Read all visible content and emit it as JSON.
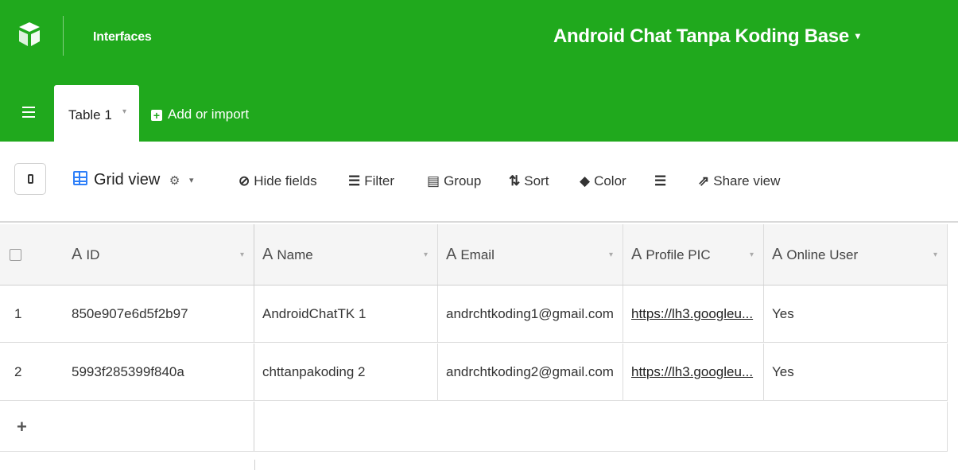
{
  "header": {
    "interfaces_label": "Interfaces",
    "base_title": "Android Chat Tanpa Koding Base",
    "base_caret": "▾",
    "brand_color": "#20a91d"
  },
  "tabbar": {
    "active_tab_label": "Table 1",
    "tab_caret": "▾",
    "add_import_label": "Add or import"
  },
  "toolbar": {
    "view_name": "Grid view",
    "view_caret": "▾",
    "hide_fields": "Hide fields",
    "filter": "Filter",
    "group": "Group",
    "sort": "Sort",
    "color": "Color",
    "share_view": "Share view"
  },
  "grid": {
    "columns": [
      {
        "type_icon": "A",
        "label": "ID"
      },
      {
        "type_icon": "A",
        "label": "Name"
      },
      {
        "type_icon": "A",
        "label": "Email"
      },
      {
        "type_icon": "A",
        "label": "Profile PIC"
      },
      {
        "type_icon": "A",
        "label": "Online User"
      }
    ],
    "rows": [
      {
        "num": "1",
        "id": "850e907e6d5f2b97",
        "name": "AndroidChatTK 1",
        "email": "andrchtkoding1@gmail.com",
        "pic": "https://lh3.googleu...",
        "online": "Yes"
      },
      {
        "num": "2",
        "id": "5993f285399f840a",
        "name": "chttanpakoding 2",
        "email": "andrchtkoding2@gmail.com",
        "pic": "https://lh3.googleu...",
        "online": "Yes"
      }
    ],
    "add_row_symbol": "+"
  }
}
